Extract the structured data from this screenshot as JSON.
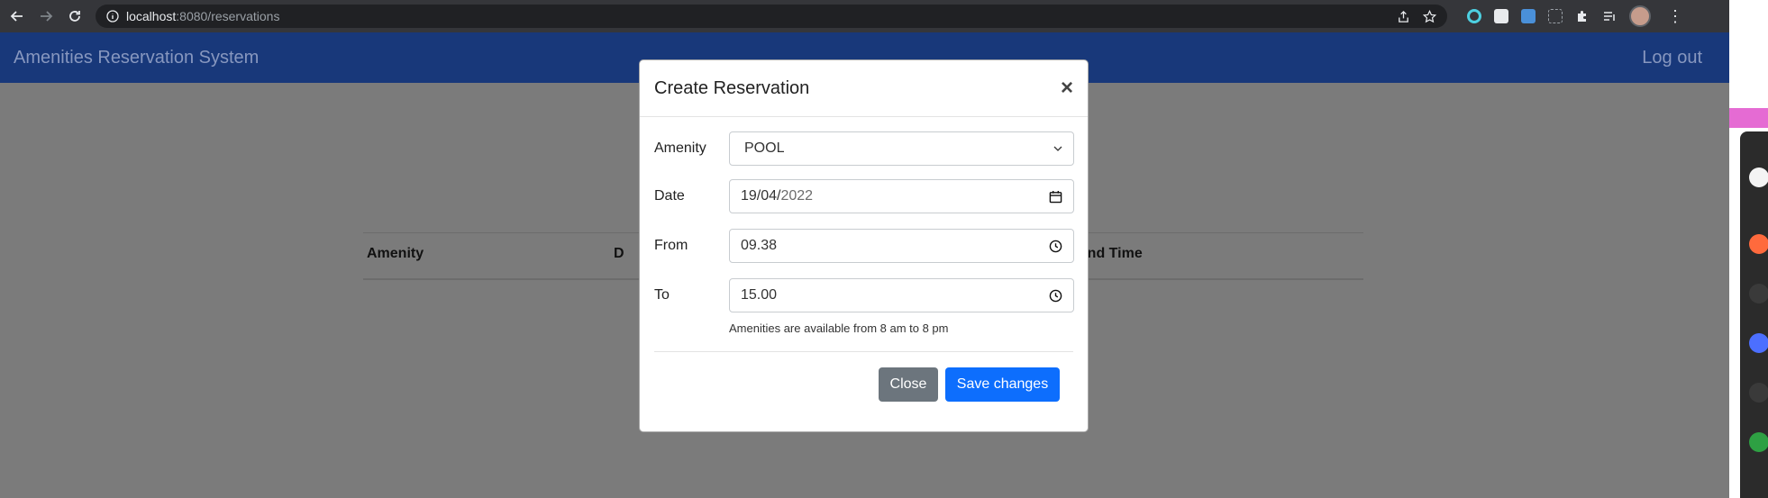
{
  "browser": {
    "url_host": "localhost",
    "url_path": ":8080/reservations"
  },
  "navbar": {
    "brand": "Amenities Reservation System",
    "logout": "Log out"
  },
  "table": {
    "headers": [
      "Amenity",
      "D",
      "End Time"
    ]
  },
  "modal": {
    "title": "Create Reservation",
    "close_symbol": "×",
    "fields": {
      "amenity": {
        "label": "Amenity",
        "value": "POOL"
      },
      "date": {
        "label": "Date",
        "value_day_month": "19/04/",
        "value_year": "2022"
      },
      "from": {
        "label": "From",
        "value": "09.38"
      },
      "to": {
        "label": "To",
        "value": "15.00"
      }
    },
    "help_text": "Amenities are available from 8 am to 8 pm",
    "buttons": {
      "close": "Close",
      "save": "Save changes"
    }
  },
  "colors": {
    "navbar": "#18387a",
    "primary": "#0d6efd",
    "secondary": "#6c757d"
  }
}
